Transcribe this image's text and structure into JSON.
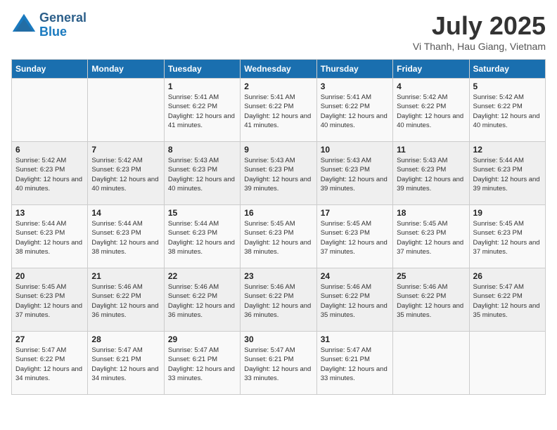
{
  "header": {
    "logo_line1": "General",
    "logo_line2": "Blue",
    "month": "July 2025",
    "location": "Vi Thanh, Hau Giang, Vietnam"
  },
  "days_of_week": [
    "Sunday",
    "Monday",
    "Tuesday",
    "Wednesday",
    "Thursday",
    "Friday",
    "Saturday"
  ],
  "weeks": [
    [
      {
        "day": "",
        "info": ""
      },
      {
        "day": "",
        "info": ""
      },
      {
        "day": "1",
        "info": "Sunrise: 5:41 AM\nSunset: 6:22 PM\nDaylight: 12 hours and 41 minutes."
      },
      {
        "day": "2",
        "info": "Sunrise: 5:41 AM\nSunset: 6:22 PM\nDaylight: 12 hours and 41 minutes."
      },
      {
        "day": "3",
        "info": "Sunrise: 5:41 AM\nSunset: 6:22 PM\nDaylight: 12 hours and 40 minutes."
      },
      {
        "day": "4",
        "info": "Sunrise: 5:42 AM\nSunset: 6:22 PM\nDaylight: 12 hours and 40 minutes."
      },
      {
        "day": "5",
        "info": "Sunrise: 5:42 AM\nSunset: 6:22 PM\nDaylight: 12 hours and 40 minutes."
      }
    ],
    [
      {
        "day": "6",
        "info": "Sunrise: 5:42 AM\nSunset: 6:23 PM\nDaylight: 12 hours and 40 minutes."
      },
      {
        "day": "7",
        "info": "Sunrise: 5:42 AM\nSunset: 6:23 PM\nDaylight: 12 hours and 40 minutes."
      },
      {
        "day": "8",
        "info": "Sunrise: 5:43 AM\nSunset: 6:23 PM\nDaylight: 12 hours and 40 minutes."
      },
      {
        "day": "9",
        "info": "Sunrise: 5:43 AM\nSunset: 6:23 PM\nDaylight: 12 hours and 39 minutes."
      },
      {
        "day": "10",
        "info": "Sunrise: 5:43 AM\nSunset: 6:23 PM\nDaylight: 12 hours and 39 minutes."
      },
      {
        "day": "11",
        "info": "Sunrise: 5:43 AM\nSunset: 6:23 PM\nDaylight: 12 hours and 39 minutes."
      },
      {
        "day": "12",
        "info": "Sunrise: 5:44 AM\nSunset: 6:23 PM\nDaylight: 12 hours and 39 minutes."
      }
    ],
    [
      {
        "day": "13",
        "info": "Sunrise: 5:44 AM\nSunset: 6:23 PM\nDaylight: 12 hours and 38 minutes."
      },
      {
        "day": "14",
        "info": "Sunrise: 5:44 AM\nSunset: 6:23 PM\nDaylight: 12 hours and 38 minutes."
      },
      {
        "day": "15",
        "info": "Sunrise: 5:44 AM\nSunset: 6:23 PM\nDaylight: 12 hours and 38 minutes."
      },
      {
        "day": "16",
        "info": "Sunrise: 5:45 AM\nSunset: 6:23 PM\nDaylight: 12 hours and 38 minutes."
      },
      {
        "day": "17",
        "info": "Sunrise: 5:45 AM\nSunset: 6:23 PM\nDaylight: 12 hours and 37 minutes."
      },
      {
        "day": "18",
        "info": "Sunrise: 5:45 AM\nSunset: 6:23 PM\nDaylight: 12 hours and 37 minutes."
      },
      {
        "day": "19",
        "info": "Sunrise: 5:45 AM\nSunset: 6:23 PM\nDaylight: 12 hours and 37 minutes."
      }
    ],
    [
      {
        "day": "20",
        "info": "Sunrise: 5:45 AM\nSunset: 6:23 PM\nDaylight: 12 hours and 37 minutes."
      },
      {
        "day": "21",
        "info": "Sunrise: 5:46 AM\nSunset: 6:22 PM\nDaylight: 12 hours and 36 minutes."
      },
      {
        "day": "22",
        "info": "Sunrise: 5:46 AM\nSunset: 6:22 PM\nDaylight: 12 hours and 36 minutes."
      },
      {
        "day": "23",
        "info": "Sunrise: 5:46 AM\nSunset: 6:22 PM\nDaylight: 12 hours and 36 minutes."
      },
      {
        "day": "24",
        "info": "Sunrise: 5:46 AM\nSunset: 6:22 PM\nDaylight: 12 hours and 35 minutes."
      },
      {
        "day": "25",
        "info": "Sunrise: 5:46 AM\nSunset: 6:22 PM\nDaylight: 12 hours and 35 minutes."
      },
      {
        "day": "26",
        "info": "Sunrise: 5:47 AM\nSunset: 6:22 PM\nDaylight: 12 hours and 35 minutes."
      }
    ],
    [
      {
        "day": "27",
        "info": "Sunrise: 5:47 AM\nSunset: 6:22 PM\nDaylight: 12 hours and 34 minutes."
      },
      {
        "day": "28",
        "info": "Sunrise: 5:47 AM\nSunset: 6:21 PM\nDaylight: 12 hours and 34 minutes."
      },
      {
        "day": "29",
        "info": "Sunrise: 5:47 AM\nSunset: 6:21 PM\nDaylight: 12 hours and 33 minutes."
      },
      {
        "day": "30",
        "info": "Sunrise: 5:47 AM\nSunset: 6:21 PM\nDaylight: 12 hours and 33 minutes."
      },
      {
        "day": "31",
        "info": "Sunrise: 5:47 AM\nSunset: 6:21 PM\nDaylight: 12 hours and 33 minutes."
      },
      {
        "day": "",
        "info": ""
      },
      {
        "day": "",
        "info": ""
      }
    ]
  ]
}
